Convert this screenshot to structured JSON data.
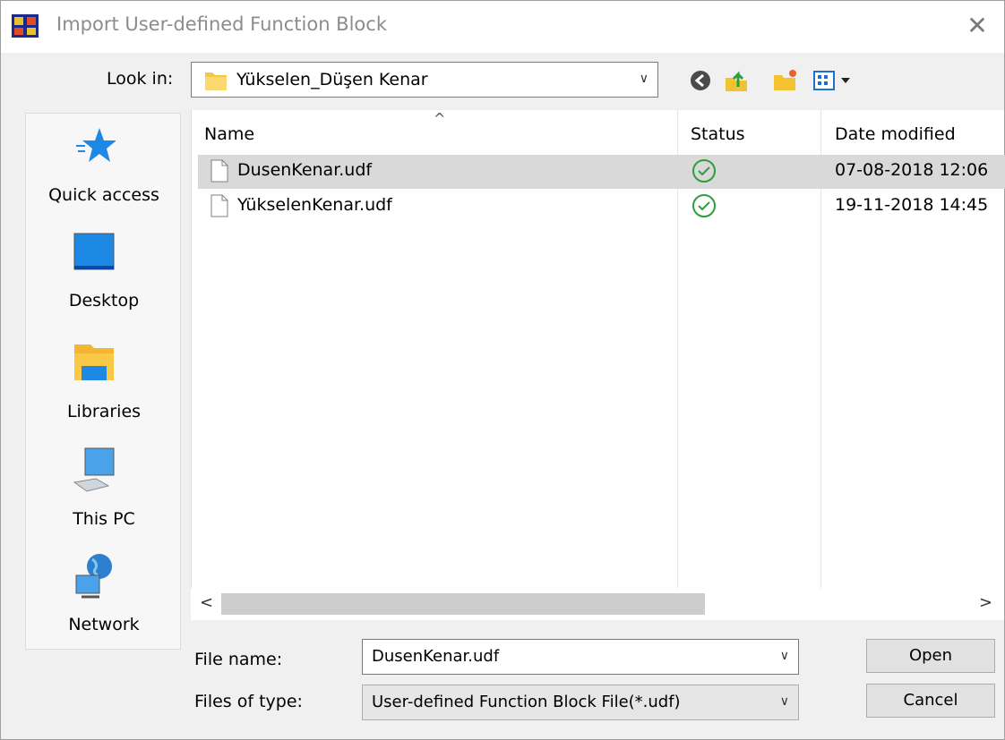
{
  "window": {
    "title": "Import User-defined Function Block",
    "close_glyph": "✕"
  },
  "toolbar": {
    "look_in_label": "Look in:",
    "look_in_value": "Yükselen_Düşen Kenar",
    "icons": [
      "back-icon",
      "up-folder-icon",
      "new-folder-icon",
      "view-menu-icon"
    ]
  },
  "places": [
    {
      "label": "Quick access",
      "icon": "quick-access-star-icon"
    },
    {
      "label": "Desktop",
      "icon": "desktop-icon"
    },
    {
      "label": "Libraries",
      "icon": "libraries-icon"
    },
    {
      "label": "This PC",
      "icon": "this-pc-icon"
    },
    {
      "label": "Network",
      "icon": "network-icon"
    }
  ],
  "file_list": {
    "columns": [
      "Name",
      "Status",
      "Date modified"
    ],
    "sort_glyph": "^",
    "files": [
      {
        "name": "DusenKenar.udf",
        "status": "check-circle-icon",
        "date": "07-08-2018 12:06",
        "selected": true
      },
      {
        "name": "YükselenKenar.udf",
        "status": "check-circle-icon",
        "date": "19-11-2018 14:45",
        "selected": false
      }
    ],
    "scroll_left_glyph": "<",
    "scroll_right_glyph": ">"
  },
  "form": {
    "file_name_label": "File name:",
    "file_name_value": "DusenKenar.udf",
    "file_type_label": "Files of type:",
    "file_type_value": "User-defined Function Block File(*.udf)",
    "dropdown_glyph": "∨"
  },
  "buttons": {
    "open": "Open",
    "cancel": "Cancel"
  },
  "colors": {
    "status_green": "#2e9e3c",
    "accent_blue": "#1e88e5",
    "selection": "#d9d9d9"
  }
}
